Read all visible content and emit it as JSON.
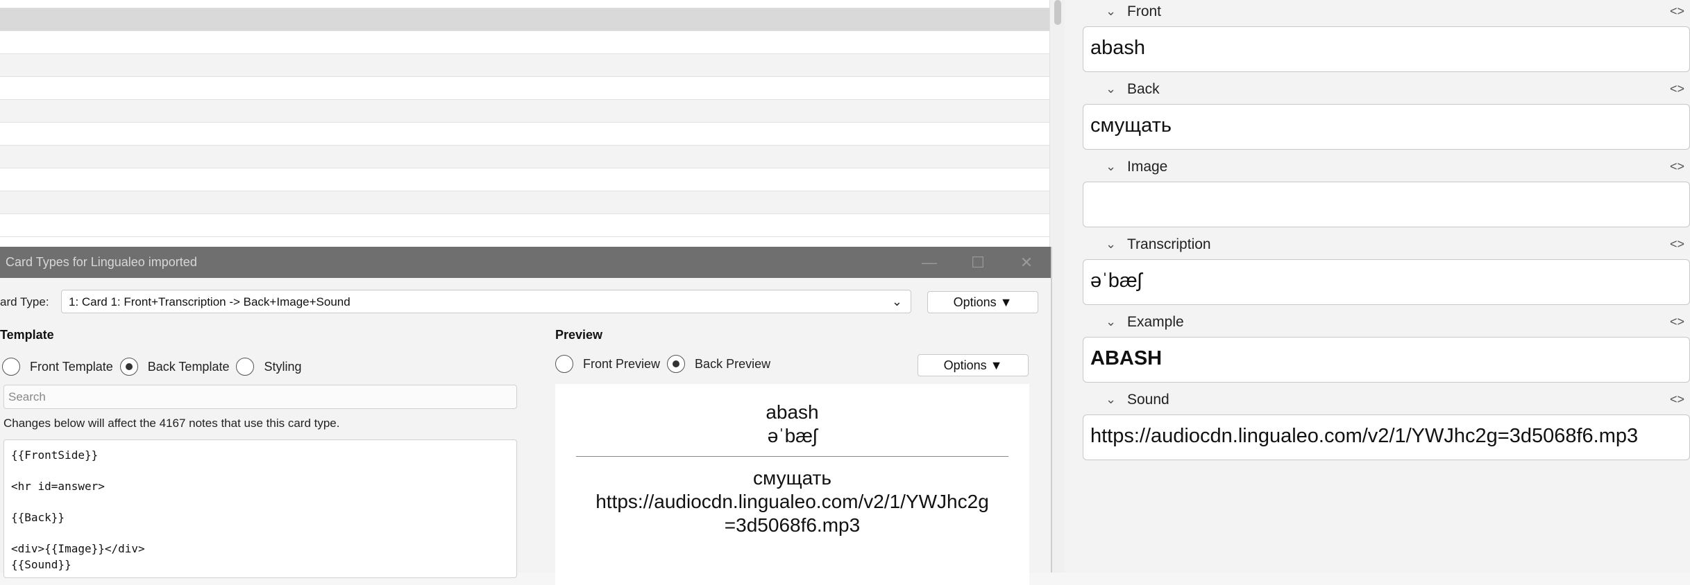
{
  "dialog": {
    "title": "Card Types for Lingualeo imported",
    "window_controls": [
      "minimize-icon",
      "maximize-icon",
      "close-icon"
    ],
    "card_type_label": "ard Type:",
    "card_type_value": "1: Card 1: Front+Transcription -> Back+Image+Sound",
    "options_label": "Options ▼",
    "template": {
      "title": "Template",
      "radios": [
        {
          "label": "Front Template",
          "checked": false
        },
        {
          "label": "Back Template",
          "checked": true
        },
        {
          "label": "Styling",
          "checked": false
        }
      ],
      "search_placeholder": "Search",
      "info": "Changes below will affect the 4167 notes that use this card type.",
      "lines": [
        "{{FrontSide}}",
        "",
        "<hr id=answer>",
        "",
        "{{Back}}",
        "",
        "<div>{{Image}}</div>",
        "{{Sound}}"
      ]
    },
    "preview": {
      "title": "Preview",
      "radios": [
        {
          "label": "Front Preview",
          "checked": false
        },
        {
          "label": "Back Preview",
          "checked": true
        }
      ],
      "options_label": "Options ▼",
      "front_word": "abash",
      "transcription": "əˈbæʃ",
      "back_word": "смущать",
      "sound_line1": "https://audiocdn.lingualeo.com/v2/1/YWJhc2g",
      "sound_line2": "=3d5068f6.mp3"
    }
  },
  "editor": {
    "fields": [
      {
        "label": "Front",
        "value": "abash",
        "bold": false
      },
      {
        "label": "Back",
        "value": "смущать",
        "bold": false
      },
      {
        "label": "Image",
        "value": "",
        "bold": false
      },
      {
        "label": "Transcription",
        "value": "əˈbæʃ",
        "bold": false
      },
      {
        "label": "Example",
        "value": "ABASH",
        "bold": true
      },
      {
        "label": "Sound",
        "value": "https://audiocdn.lingualeo.com/v2/1/YWJhc2g=3d5068f6.mp3",
        "bold": false
      }
    ],
    "collapse_icon": "chevron-down-icon",
    "html_toggle_icon": "code-toggle-icon"
  },
  "colors": {
    "titlebar": "#6f6f6f",
    "selected_row": "#d9d9d9"
  }
}
